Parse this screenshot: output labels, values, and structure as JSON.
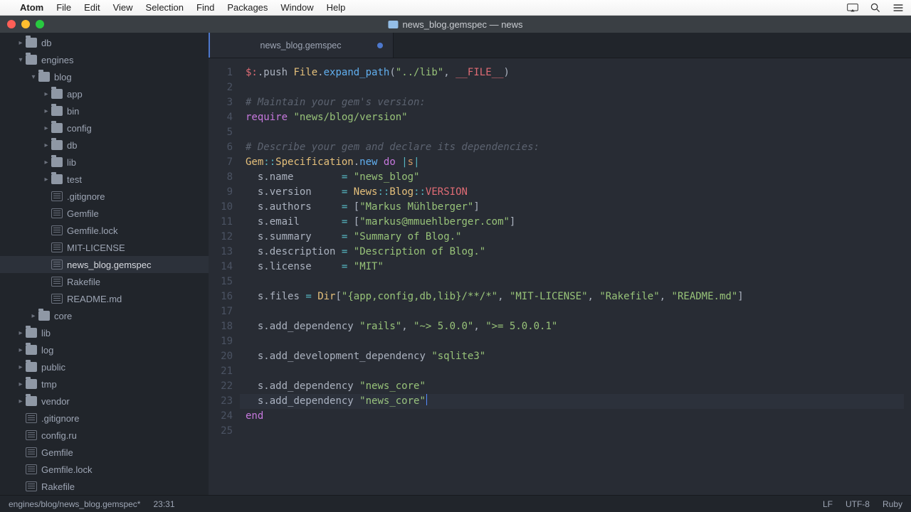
{
  "menubar": {
    "app": "Atom",
    "items": [
      "File",
      "Edit",
      "View",
      "Selection",
      "Find",
      "Packages",
      "Window",
      "Help"
    ]
  },
  "window": {
    "title": "news_blog.gemspec — news"
  },
  "sidebar": {
    "items": [
      {
        "depth": 1,
        "caret": "closed",
        "type": "folder",
        "label": "db"
      },
      {
        "depth": 1,
        "caret": "open",
        "type": "folder",
        "label": "engines"
      },
      {
        "depth": 2,
        "caret": "open",
        "type": "folder",
        "label": "blog"
      },
      {
        "depth": 3,
        "caret": "closed",
        "type": "folder",
        "label": "app"
      },
      {
        "depth": 3,
        "caret": "closed",
        "type": "folder",
        "label": "bin"
      },
      {
        "depth": 3,
        "caret": "closed",
        "type": "folder",
        "label": "config"
      },
      {
        "depth": 3,
        "caret": "closed",
        "type": "folder",
        "label": "db"
      },
      {
        "depth": 3,
        "caret": "closed",
        "type": "folder",
        "label": "lib"
      },
      {
        "depth": 3,
        "caret": "closed",
        "type": "folder",
        "label": "test"
      },
      {
        "depth": 3,
        "caret": "none",
        "type": "file",
        "label": ".gitignore"
      },
      {
        "depth": 3,
        "caret": "none",
        "type": "file",
        "label": "Gemfile"
      },
      {
        "depth": 3,
        "caret": "none",
        "type": "file",
        "label": "Gemfile.lock"
      },
      {
        "depth": 3,
        "caret": "none",
        "type": "file",
        "label": "MIT-LICENSE"
      },
      {
        "depth": 3,
        "caret": "none",
        "type": "file",
        "label": "news_blog.gemspec",
        "selected": true
      },
      {
        "depth": 3,
        "caret": "none",
        "type": "file",
        "label": "Rakefile"
      },
      {
        "depth": 3,
        "caret": "none",
        "type": "file",
        "label": "README.md"
      },
      {
        "depth": 2,
        "caret": "closed",
        "type": "folder",
        "label": "core"
      },
      {
        "depth": 1,
        "caret": "closed",
        "type": "folder",
        "label": "lib"
      },
      {
        "depth": 1,
        "caret": "closed",
        "type": "folder",
        "label": "log"
      },
      {
        "depth": 1,
        "caret": "closed",
        "type": "folder",
        "label": "public"
      },
      {
        "depth": 1,
        "caret": "closed",
        "type": "folder",
        "label": "tmp"
      },
      {
        "depth": 1,
        "caret": "closed",
        "type": "folder",
        "label": "vendor"
      },
      {
        "depth": 1,
        "caret": "none",
        "type": "file",
        "label": ".gitignore"
      },
      {
        "depth": 1,
        "caret": "none",
        "type": "file",
        "label": "config.ru"
      },
      {
        "depth": 1,
        "caret": "none",
        "type": "file",
        "label": "Gemfile"
      },
      {
        "depth": 1,
        "caret": "none",
        "type": "file",
        "label": "Gemfile.lock"
      },
      {
        "depth": 1,
        "caret": "none",
        "type": "file",
        "label": "Rakefile"
      }
    ]
  },
  "tab": {
    "label": "news_blog.gemspec",
    "modified": true
  },
  "code": {
    "lines": [
      [
        [
          "var",
          "$:"
        ],
        [
          "punc",
          "."
        ],
        [
          "txt",
          "push "
        ],
        [
          "cls",
          "File"
        ],
        [
          "punc",
          "."
        ],
        [
          "fn",
          "expand_path"
        ],
        [
          "punc",
          "("
        ],
        [
          "str",
          "\"../lib\""
        ],
        [
          "punc",
          ", "
        ],
        [
          "var",
          "__FILE__"
        ],
        [
          "punc",
          ")"
        ]
      ],
      [],
      [
        [
          "cmt",
          "# Maintain your gem's version:"
        ]
      ],
      [
        [
          "kw",
          "require"
        ],
        [
          "txt",
          " "
        ],
        [
          "str",
          "\"news/blog/version\""
        ]
      ],
      [],
      [
        [
          "cmt",
          "# Describe your gem and declare its dependencies:"
        ]
      ],
      [
        [
          "cls",
          "Gem"
        ],
        [
          "op",
          "::"
        ],
        [
          "cls",
          "Specification"
        ],
        [
          "punc",
          "."
        ],
        [
          "fn",
          "new"
        ],
        [
          "txt",
          " "
        ],
        [
          "kw",
          "do"
        ],
        [
          "txt",
          " "
        ],
        [
          "op",
          "|"
        ],
        [
          "num",
          "s"
        ],
        [
          "op",
          "|"
        ]
      ],
      [
        [
          "txt",
          "  s"
        ],
        [
          "punc",
          "."
        ],
        [
          "txt",
          "name        "
        ],
        [
          "op",
          "="
        ],
        [
          "txt",
          " "
        ],
        [
          "str",
          "\"news_blog\""
        ]
      ],
      [
        [
          "txt",
          "  s"
        ],
        [
          "punc",
          "."
        ],
        [
          "txt",
          "version     "
        ],
        [
          "op",
          "="
        ],
        [
          "txt",
          " "
        ],
        [
          "cls",
          "News"
        ],
        [
          "op",
          "::"
        ],
        [
          "cls",
          "Blog"
        ],
        [
          "op",
          "::"
        ],
        [
          "var",
          "VERSION"
        ]
      ],
      [
        [
          "txt",
          "  s"
        ],
        [
          "punc",
          "."
        ],
        [
          "txt",
          "authors     "
        ],
        [
          "op",
          "="
        ],
        [
          "txt",
          " "
        ],
        [
          "punc",
          "["
        ],
        [
          "str",
          "\"Markus Mühlberger\""
        ],
        [
          "punc",
          "]"
        ]
      ],
      [
        [
          "txt",
          "  s"
        ],
        [
          "punc",
          "."
        ],
        [
          "txt",
          "email       "
        ],
        [
          "op",
          "="
        ],
        [
          "txt",
          " "
        ],
        [
          "punc",
          "["
        ],
        [
          "str",
          "\"markus@mmuehlberger.com\""
        ],
        [
          "punc",
          "]"
        ]
      ],
      [
        [
          "txt",
          "  s"
        ],
        [
          "punc",
          "."
        ],
        [
          "txt",
          "summary     "
        ],
        [
          "op",
          "="
        ],
        [
          "txt",
          " "
        ],
        [
          "str",
          "\"Summary of Blog.\""
        ]
      ],
      [
        [
          "txt",
          "  s"
        ],
        [
          "punc",
          "."
        ],
        [
          "txt",
          "description "
        ],
        [
          "op",
          "="
        ],
        [
          "txt",
          " "
        ],
        [
          "str",
          "\"Description of Blog.\""
        ]
      ],
      [
        [
          "txt",
          "  s"
        ],
        [
          "punc",
          "."
        ],
        [
          "txt",
          "license     "
        ],
        [
          "op",
          "="
        ],
        [
          "txt",
          " "
        ],
        [
          "str",
          "\"MIT\""
        ]
      ],
      [],
      [
        [
          "txt",
          "  s"
        ],
        [
          "punc",
          "."
        ],
        [
          "txt",
          "files "
        ],
        [
          "op",
          "="
        ],
        [
          "txt",
          " "
        ],
        [
          "cls",
          "Dir"
        ],
        [
          "punc",
          "["
        ],
        [
          "str",
          "\"{app,config,db,lib}/**/*\""
        ],
        [
          "punc",
          ", "
        ],
        [
          "str",
          "\"MIT-LICENSE\""
        ],
        [
          "punc",
          ", "
        ],
        [
          "str",
          "\"Rakefile\""
        ],
        [
          "punc",
          ", "
        ],
        [
          "str",
          "\"README.md\""
        ],
        [
          "punc",
          "]"
        ]
      ],
      [],
      [
        [
          "txt",
          "  s"
        ],
        [
          "punc",
          "."
        ],
        [
          "txt",
          "add_dependency "
        ],
        [
          "str",
          "\"rails\""
        ],
        [
          "punc",
          ", "
        ],
        [
          "str",
          "\"~> 5.0.0\""
        ],
        [
          "punc",
          ", "
        ],
        [
          "str",
          "\">= 5.0.0.1\""
        ]
      ],
      [],
      [
        [
          "txt",
          "  s"
        ],
        [
          "punc",
          "."
        ],
        [
          "txt",
          "add_development_dependency "
        ],
        [
          "str",
          "\"sqlite3\""
        ]
      ],
      [],
      [
        [
          "txt",
          "  s"
        ],
        [
          "punc",
          "."
        ],
        [
          "txt",
          "add_dependency "
        ],
        [
          "str",
          "\"news_core\""
        ]
      ],
      [
        [
          "txt",
          "  s"
        ],
        [
          "punc",
          "."
        ],
        [
          "txt",
          "add_dependency "
        ],
        [
          "str",
          "\"news_core\""
        ]
      ],
      [
        [
          "kw",
          "end"
        ]
      ],
      []
    ],
    "cursor_line": 23
  },
  "status": {
    "path": "engines/blog/news_blog.gemspec*",
    "position": "23:31",
    "eol": "LF",
    "encoding": "UTF-8",
    "grammar": "Ruby"
  }
}
